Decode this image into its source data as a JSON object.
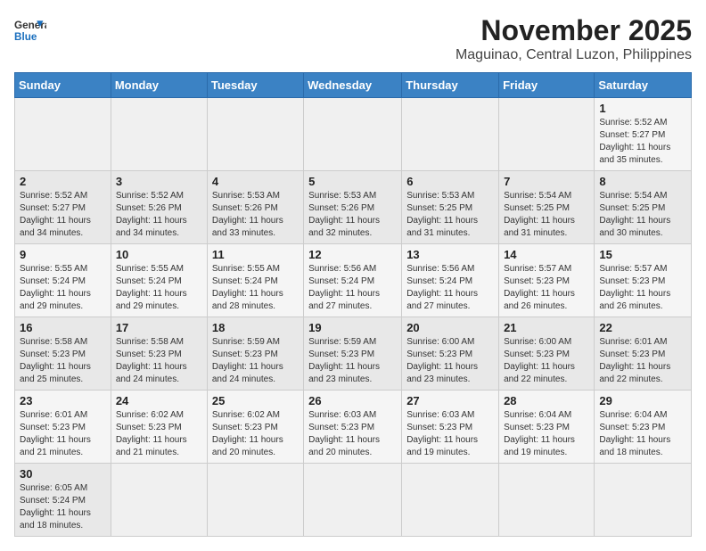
{
  "header": {
    "logo_general": "General",
    "logo_blue": "Blue",
    "month": "November 2025",
    "location": "Maguinao, Central Luzon, Philippines"
  },
  "weekdays": [
    "Sunday",
    "Monday",
    "Tuesday",
    "Wednesday",
    "Thursday",
    "Friday",
    "Saturday"
  ],
  "weeks": [
    [
      {
        "day": "",
        "info": ""
      },
      {
        "day": "",
        "info": ""
      },
      {
        "day": "",
        "info": ""
      },
      {
        "day": "",
        "info": ""
      },
      {
        "day": "",
        "info": ""
      },
      {
        "day": "",
        "info": ""
      },
      {
        "day": "1",
        "info": "Sunrise: 5:52 AM\nSunset: 5:27 PM\nDaylight: 11 hours\nand 35 minutes."
      }
    ],
    [
      {
        "day": "2",
        "info": "Sunrise: 5:52 AM\nSunset: 5:27 PM\nDaylight: 11 hours\nand 34 minutes."
      },
      {
        "day": "3",
        "info": "Sunrise: 5:52 AM\nSunset: 5:26 PM\nDaylight: 11 hours\nand 34 minutes."
      },
      {
        "day": "4",
        "info": "Sunrise: 5:53 AM\nSunset: 5:26 PM\nDaylight: 11 hours\nand 33 minutes."
      },
      {
        "day": "5",
        "info": "Sunrise: 5:53 AM\nSunset: 5:26 PM\nDaylight: 11 hours\nand 32 minutes."
      },
      {
        "day": "6",
        "info": "Sunrise: 5:53 AM\nSunset: 5:25 PM\nDaylight: 11 hours\nand 31 minutes."
      },
      {
        "day": "7",
        "info": "Sunrise: 5:54 AM\nSunset: 5:25 PM\nDaylight: 11 hours\nand 31 minutes."
      },
      {
        "day": "8",
        "info": "Sunrise: 5:54 AM\nSunset: 5:25 PM\nDaylight: 11 hours\nand 30 minutes."
      }
    ],
    [
      {
        "day": "9",
        "info": "Sunrise: 5:55 AM\nSunset: 5:24 PM\nDaylight: 11 hours\nand 29 minutes."
      },
      {
        "day": "10",
        "info": "Sunrise: 5:55 AM\nSunset: 5:24 PM\nDaylight: 11 hours\nand 29 minutes."
      },
      {
        "day": "11",
        "info": "Sunrise: 5:55 AM\nSunset: 5:24 PM\nDaylight: 11 hours\nand 28 minutes."
      },
      {
        "day": "12",
        "info": "Sunrise: 5:56 AM\nSunset: 5:24 PM\nDaylight: 11 hours\nand 27 minutes."
      },
      {
        "day": "13",
        "info": "Sunrise: 5:56 AM\nSunset: 5:24 PM\nDaylight: 11 hours\nand 27 minutes."
      },
      {
        "day": "14",
        "info": "Sunrise: 5:57 AM\nSunset: 5:23 PM\nDaylight: 11 hours\nand 26 minutes."
      },
      {
        "day": "15",
        "info": "Sunrise: 5:57 AM\nSunset: 5:23 PM\nDaylight: 11 hours\nand 26 minutes."
      }
    ],
    [
      {
        "day": "16",
        "info": "Sunrise: 5:58 AM\nSunset: 5:23 PM\nDaylight: 11 hours\nand 25 minutes."
      },
      {
        "day": "17",
        "info": "Sunrise: 5:58 AM\nSunset: 5:23 PM\nDaylight: 11 hours\nand 24 minutes."
      },
      {
        "day": "18",
        "info": "Sunrise: 5:59 AM\nSunset: 5:23 PM\nDaylight: 11 hours\nand 24 minutes."
      },
      {
        "day": "19",
        "info": "Sunrise: 5:59 AM\nSunset: 5:23 PM\nDaylight: 11 hours\nand 23 minutes."
      },
      {
        "day": "20",
        "info": "Sunrise: 6:00 AM\nSunset: 5:23 PM\nDaylight: 11 hours\nand 23 minutes."
      },
      {
        "day": "21",
        "info": "Sunrise: 6:00 AM\nSunset: 5:23 PM\nDaylight: 11 hours\nand 22 minutes."
      },
      {
        "day": "22",
        "info": "Sunrise: 6:01 AM\nSunset: 5:23 PM\nDaylight: 11 hours\nand 22 minutes."
      }
    ],
    [
      {
        "day": "23",
        "info": "Sunrise: 6:01 AM\nSunset: 5:23 PM\nDaylight: 11 hours\nand 21 minutes."
      },
      {
        "day": "24",
        "info": "Sunrise: 6:02 AM\nSunset: 5:23 PM\nDaylight: 11 hours\nand 21 minutes."
      },
      {
        "day": "25",
        "info": "Sunrise: 6:02 AM\nSunset: 5:23 PM\nDaylight: 11 hours\nand 20 minutes."
      },
      {
        "day": "26",
        "info": "Sunrise: 6:03 AM\nSunset: 5:23 PM\nDaylight: 11 hours\nand 20 minutes."
      },
      {
        "day": "27",
        "info": "Sunrise: 6:03 AM\nSunset: 5:23 PM\nDaylight: 11 hours\nand 19 minutes."
      },
      {
        "day": "28",
        "info": "Sunrise: 6:04 AM\nSunset: 5:23 PM\nDaylight: 11 hours\nand 19 minutes."
      },
      {
        "day": "29",
        "info": "Sunrise: 6:04 AM\nSunset: 5:23 PM\nDaylight: 11 hours\nand 18 minutes."
      }
    ],
    [
      {
        "day": "30",
        "info": "Sunrise: 6:05 AM\nSunset: 5:24 PM\nDaylight: 11 hours\nand 18 minutes."
      },
      {
        "day": "",
        "info": ""
      },
      {
        "day": "",
        "info": ""
      },
      {
        "day": "",
        "info": ""
      },
      {
        "day": "",
        "info": ""
      },
      {
        "day": "",
        "info": ""
      },
      {
        "day": "",
        "info": ""
      }
    ]
  ]
}
